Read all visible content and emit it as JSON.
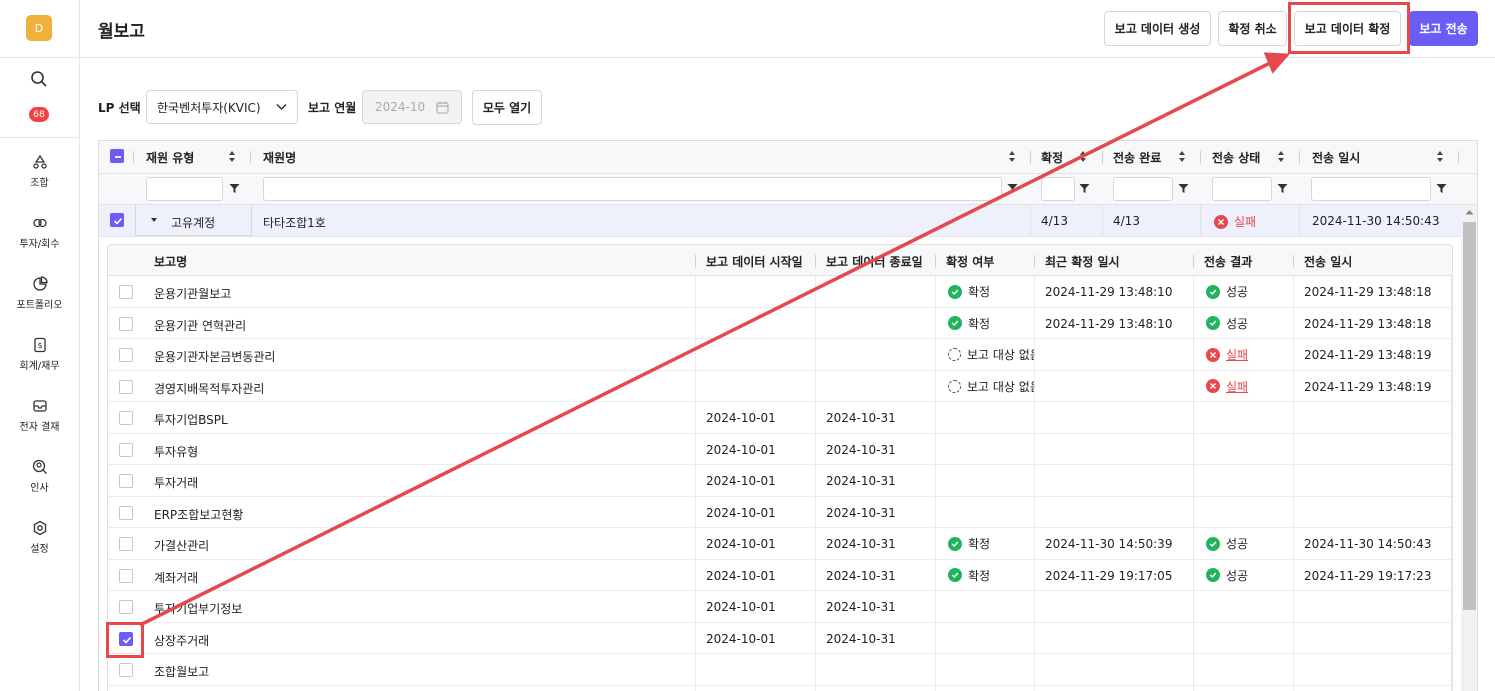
{
  "sidebar": {
    "avatar_letter": "D",
    "notification_count": "68",
    "items": [
      {
        "label": "조합",
        "icon": "recycle-icon"
      },
      {
        "label": "투자/회수",
        "icon": "exchange-icon"
      },
      {
        "label": "포트폴리오",
        "icon": "pie-chart-icon"
      },
      {
        "label": "회계/재무",
        "icon": "invoice-icon"
      },
      {
        "label": "전자 결재",
        "icon": "inbox-icon"
      },
      {
        "label": "인사",
        "icon": "user-search-icon"
      },
      {
        "label": "설정",
        "icon": "settings-icon"
      }
    ]
  },
  "header": {
    "title": "월보고",
    "buttons": {
      "generate": "보고 데이터 생성",
      "cancel_confirm": "확정 취소",
      "confirm": "보고 데이터 확정",
      "send": "보고 전송"
    }
  },
  "filters": {
    "lp_label": "LP 선택",
    "lp_value": "한국벤처투자(KVIC)",
    "period_label": "보고 연월",
    "period_value": "2024-10",
    "open_all": "모두 열기"
  },
  "grid": {
    "columns": [
      "재원 유형",
      "재원명",
      "확정",
      "전송 완료",
      "전송 상태",
      "전송 일시"
    ],
    "group_row": {
      "type": "고유계정",
      "name": "타타조합1호",
      "confirmed": "4/13",
      "sent": "4/13",
      "send_status": "실패",
      "sent_at": "2024-11-30 14:50:43"
    }
  },
  "detail": {
    "columns": [
      "보고명",
      "보고 데이터 시작일",
      "보고 데이터 종료일",
      "확정 여부",
      "최근 확정 일시",
      "전송 결과",
      "전송 일시"
    ],
    "rows": [
      {
        "name": "운용기관월보고",
        "start": "",
        "end": "",
        "confirm": "확정",
        "confirm_type": "ok",
        "confirmed_at": "2024-11-29 13:48:10",
        "result": "성공",
        "result_type": "ok",
        "sent_at": "2024-11-29 13:48:18",
        "checked": false
      },
      {
        "name": "운용기관 연혁관리",
        "start": "",
        "end": "",
        "confirm": "확정",
        "confirm_type": "ok",
        "confirmed_at": "2024-11-29 13:48:10",
        "result": "성공",
        "result_type": "ok",
        "sent_at": "2024-11-29 13:48:18",
        "checked": false
      },
      {
        "name": "운용기관자본금변동관리",
        "start": "",
        "end": "",
        "confirm": "보고 대상 없음",
        "confirm_type": "pend",
        "confirmed_at": "",
        "result": "실패",
        "result_type": "err",
        "sent_at": "2024-11-29 13:48:19",
        "checked": false
      },
      {
        "name": "경영지배목적투자관리",
        "start": "",
        "end": "",
        "confirm": "보고 대상 없음",
        "confirm_type": "pend",
        "confirmed_at": "",
        "result": "실패",
        "result_type": "err",
        "sent_at": "2024-11-29 13:48:19",
        "checked": false
      },
      {
        "name": "투자기업BSPL",
        "start": "2024-10-01",
        "end": "2024-10-31",
        "confirm": "",
        "confirm_type": "",
        "confirmed_at": "",
        "result": "",
        "result_type": "",
        "sent_at": "",
        "checked": false
      },
      {
        "name": "투자유형",
        "start": "2024-10-01",
        "end": "2024-10-31",
        "confirm": "",
        "confirm_type": "",
        "confirmed_at": "",
        "result": "",
        "result_type": "",
        "sent_at": "",
        "checked": false
      },
      {
        "name": "투자거래",
        "start": "2024-10-01",
        "end": "2024-10-31",
        "confirm": "",
        "confirm_type": "",
        "confirmed_at": "",
        "result": "",
        "result_type": "",
        "sent_at": "",
        "checked": false
      },
      {
        "name": "ERP조합보고현황",
        "start": "2024-10-01",
        "end": "2024-10-31",
        "confirm": "",
        "confirm_type": "",
        "confirmed_at": "",
        "result": "",
        "result_type": "",
        "sent_at": "",
        "checked": false
      },
      {
        "name": "가결산관리",
        "start": "2024-10-01",
        "end": "2024-10-31",
        "confirm": "확정",
        "confirm_type": "ok",
        "confirmed_at": "2024-11-30 14:50:39",
        "result": "성공",
        "result_type": "ok",
        "sent_at": "2024-11-30 14:50:43",
        "checked": false
      },
      {
        "name": "계좌거래",
        "start": "2024-10-01",
        "end": "2024-10-31",
        "confirm": "확정",
        "confirm_type": "ok",
        "confirmed_at": "2024-11-29 19:17:05",
        "result": "성공",
        "result_type": "ok",
        "sent_at": "2024-11-29 19:17:23",
        "checked": false
      },
      {
        "name": "투자기업부기정보",
        "start": "2024-10-01",
        "end": "2024-10-31",
        "confirm": "",
        "confirm_type": "",
        "confirmed_at": "",
        "result": "",
        "result_type": "",
        "sent_at": "",
        "checked": false
      },
      {
        "name": "상장주거래",
        "start": "2024-10-01",
        "end": "2024-10-31",
        "confirm": "",
        "confirm_type": "",
        "confirmed_at": "",
        "result": "",
        "result_type": "",
        "sent_at": "",
        "checked": true
      },
      {
        "name": "조합월보고",
        "start": "",
        "end": "",
        "confirm": "",
        "confirm_type": "",
        "confirmed_at": "",
        "result": "",
        "result_type": "",
        "sent_at": "",
        "checked": false
      }
    ]
  },
  "colors": {
    "primary": "#6c5cf6",
    "success": "#22b35e",
    "error": "#e5484d",
    "annotation": "#e5484d"
  }
}
